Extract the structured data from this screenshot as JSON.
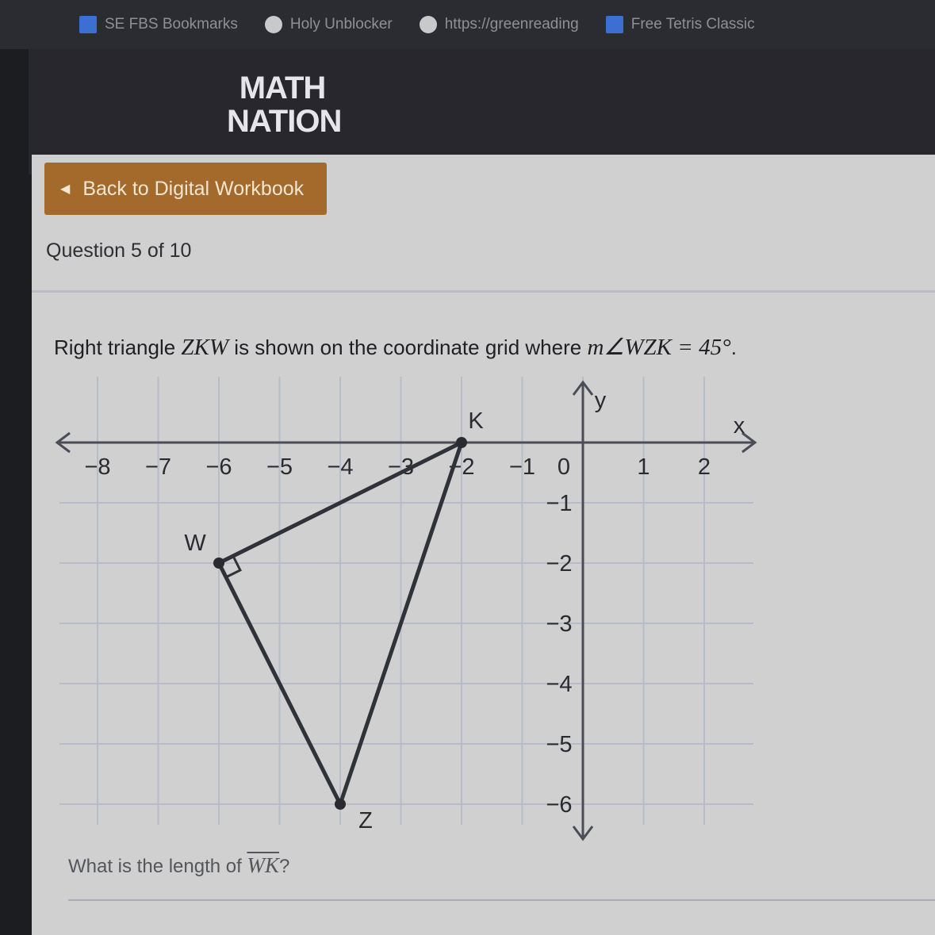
{
  "bookmarks": [
    {
      "label": "SE FBS Bookmarks",
      "icon": "folder-icon"
    },
    {
      "label": "Holy Unblocker",
      "icon": "globe-icon"
    },
    {
      "label": "https://greenreading",
      "icon": "globe-icon"
    },
    {
      "label": "Free Tetris Classic",
      "icon": "game-icon"
    }
  ],
  "logo": {
    "line1": "MATH",
    "line2": "NATION"
  },
  "back_button": {
    "label": "Back to Digital Workbook"
  },
  "question": {
    "number_text": "Question 5 of 10",
    "prompt_pre": "Right triangle ",
    "prompt_triangle": "ZKW",
    "prompt_mid": " is shown on the coordinate grid where ",
    "prompt_angle": "m∠WZK = 45°",
    "prompt_end": ".",
    "ask_pre": "What is the length of ",
    "ask_segment": "WK",
    "ask_end": "?"
  },
  "graph": {
    "axis_x_label": "x",
    "axis_y_label": "y",
    "x_ticks": [
      "−8",
      "−7",
      "−6",
      "−5",
      "−4",
      "−3",
      "−2",
      "−1",
      "0",
      "1",
      "2"
    ],
    "y_ticks": [
      "−1",
      "−2",
      "−3",
      "−4",
      "−5",
      "−6"
    ],
    "points": [
      {
        "name": "K",
        "x": -2,
        "y": 0
      },
      {
        "name": "W",
        "x": -6,
        "y": -2
      },
      {
        "name": "Z",
        "x": -4,
        "y": -6
      }
    ],
    "right_angle_at": "W"
  },
  "colors": {
    "accent_button": "#a36a2c",
    "content_bg": "#cfd0cf",
    "header_bg": "#27272d"
  }
}
